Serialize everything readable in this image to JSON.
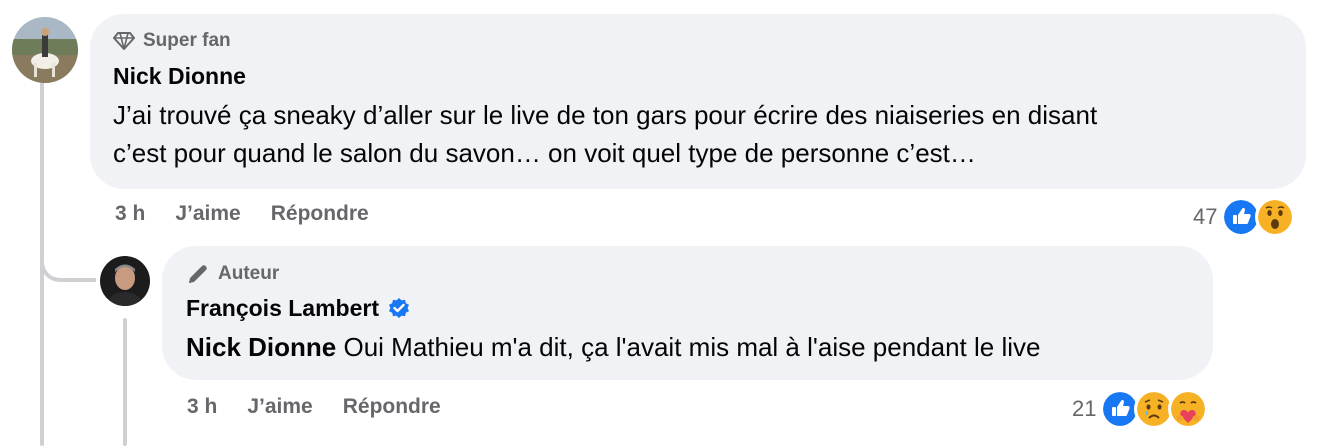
{
  "comment": {
    "badge": "Super fan",
    "author": "Nick Dionne",
    "text_line1": "J’ai trouvé ça sneaky d’aller sur le live de ton gars pour écrire des niaiseries en disant",
    "text_line2": "c’est pour quand le salon du savon… on voit quel type de personne c’est…",
    "time": "3 h",
    "like_label": "J’aime",
    "reply_label": "Répondre",
    "reaction_count": "47",
    "reactions": [
      "like-icon",
      "wow-icon"
    ]
  },
  "reply": {
    "badge": "Auteur",
    "author": "François Lambert",
    "verified": true,
    "mention": "Nick Dionne",
    "text": " Oui Mathieu m'a dit, ça l'avait mis mal à l'aise pendant le live",
    "time": "3 h",
    "like_label": "J’aime",
    "reply_label": "Répondre",
    "reaction_count": "21",
    "reactions": [
      "like-icon",
      "sad-icon",
      "care-icon"
    ]
  },
  "colors": {
    "bubble": "#f0f2f5",
    "secondary_text": "#65676b",
    "like_blue": "#1877f2",
    "reaction_yellow": "#f7b125",
    "thread_line": "#ced0d4"
  }
}
